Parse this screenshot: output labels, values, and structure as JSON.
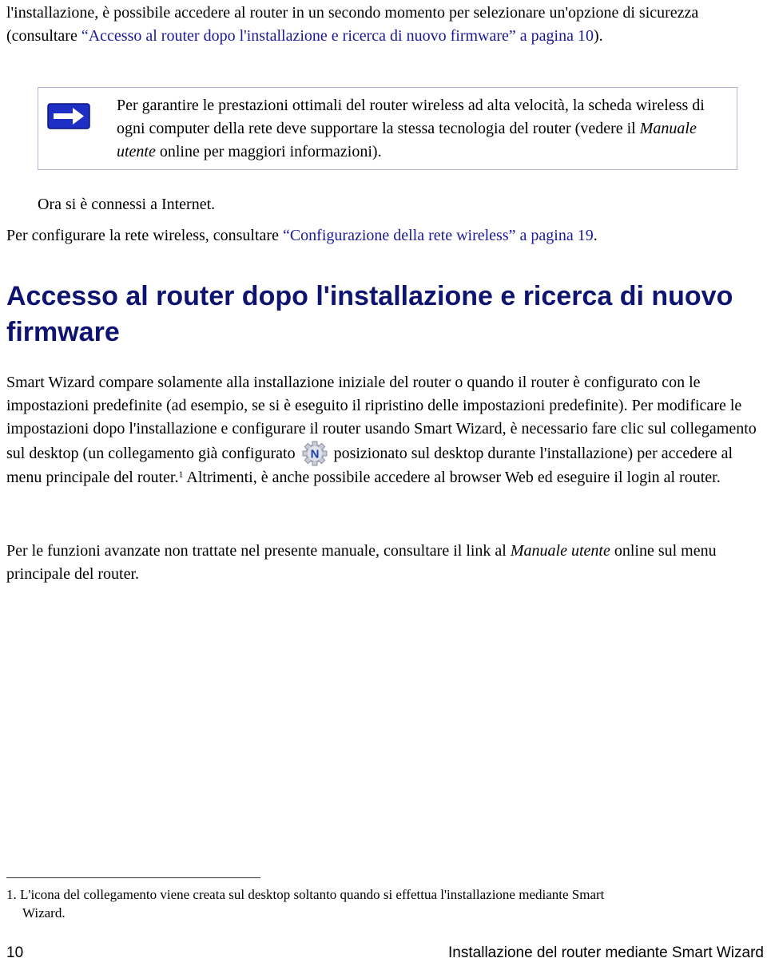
{
  "intro_paragraph": {
    "text_before_link": "l'installazione, è possibile accedere al router in un secondo momento per selezionare un'opzione di sicurezza (consultare ",
    "link_text": "“Accesso al router dopo l'installazione e ricerca di nuovo firmware” a pagina 10",
    "text_after_link": ")."
  },
  "note": {
    "icon": "arrow-right-icon",
    "text_before_italic": "Per garantire le prestazioni ottimali del router wireless ad alta velocità, la scheda wireless di ogni computer della rete deve supportare la stessa tecnologia del router (vedere il ",
    "italic": "Manuale utente",
    "text_after_italic": " online per maggiori informazioni)."
  },
  "connected_text": "Ora si è connessi a Internet.",
  "wireless_paragraph": {
    "text_before_link": "Per configurare la rete wireless, consultare ",
    "link_text": " “Configurazione della rete wireless” a pagina 19",
    "text_after_link": "."
  },
  "section_heading": "Accesso al router dopo l'installazione e ricerca di nuovo firmware",
  "smart_wizard_paragraph": {
    "text_before_icon": "Smart Wizard compare solamente alla installazione iniziale del router o quando il router è configurato con le impostazioni predefinite (ad esempio, se si è eseguito il ripristino delle impostazioni predefinite). Per modificare le impostazioni dopo l'installazione e configurare il router usando Smart Wizard, è necessario fare clic sul collegamento sul desktop (un collegamento già configurato",
    "icon": "netgear-gear-icon",
    "text_after_icon": "posizionato sul desktop durante l'installazione) per accedere al menu principale del router.",
    "footnote_ref": "1",
    "text_after_ref": " Altrimenti, è anche possibile accedere al browser Web ed eseguire il login al router."
  },
  "advanced_paragraph": {
    "text_before_italic": "Per le funzioni avanzate non trattate nel presente manuale, consultare il link al ",
    "italic": "Manuale utente",
    "text_after_italic": " online sul menu principale del router."
  },
  "footnote": {
    "number": "1.",
    "text": " L'icona del collegamento viene creata sul desktop soltanto quando si effettua l'installazione mediante Smart",
    "continuation": "Wizard."
  },
  "footer": {
    "page_number": "10",
    "chapter_title": "Installazione del router mediante Smart Wizard"
  },
  "colors": {
    "link": "#1a1a9a",
    "heading": "#0f1470",
    "note_border": "#b4b4d4",
    "note_icon": "#1d2fc4"
  }
}
